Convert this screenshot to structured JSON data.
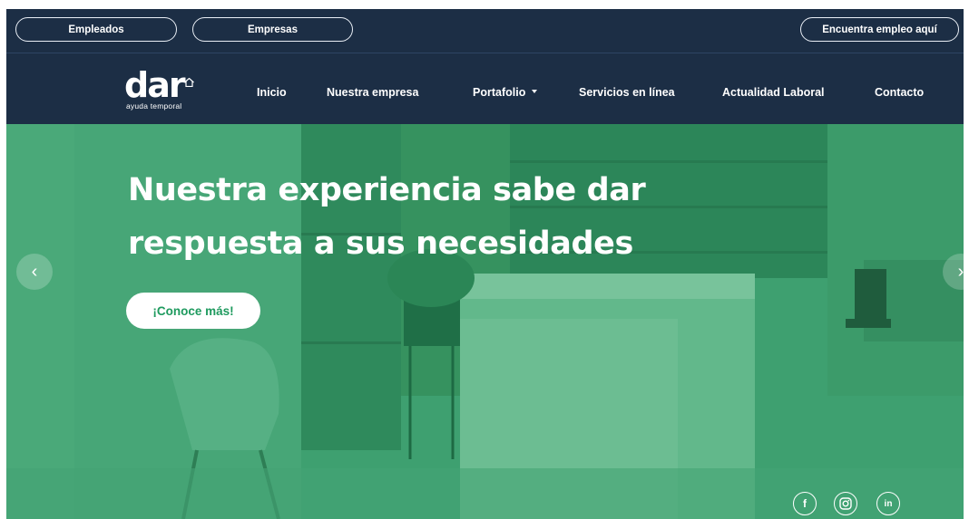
{
  "topbar": {
    "empleados": "Empleados",
    "empresas": "Empresas",
    "encuentra": "Encuentra empleo aquí"
  },
  "logo": {
    "word": "dar",
    "sub": "ayuda temporal"
  },
  "nav": {
    "inicio": "Inicio",
    "nuestra": "Nuestra empresa",
    "portafolio": "Portafolio",
    "servicios": "Servicios en línea",
    "actualidad": "Actualidad Laboral",
    "contacto": "Contacto"
  },
  "hero": {
    "title_line1": "Nuestra experiencia sabe dar",
    "title_line2": "respuesta a sus necesidades",
    "cta": "¡Conoce más!",
    "prev": "‹",
    "next": "›"
  },
  "social": {
    "facebook": "f",
    "instagram_icon": "instagram-icon",
    "linkedin": "in"
  },
  "colors": {
    "navy": "#1c2e45",
    "hero_green": "#3fa171",
    "cta_text": "#1e9a5e"
  }
}
